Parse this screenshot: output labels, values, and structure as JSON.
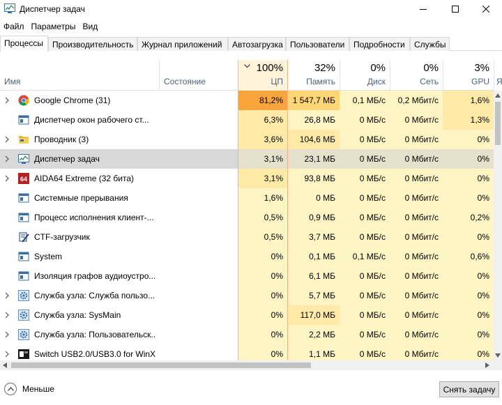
{
  "window": {
    "title": "Диспетчер задач"
  },
  "menu": [
    "Файл",
    "Параметры",
    "Вид"
  ],
  "tabs": [
    "Процессы",
    "Производительность",
    "Журнал приложений",
    "Автозагрузка",
    "Пользователи",
    "Подробности",
    "Службы"
  ],
  "columns": {
    "name": "Имя",
    "status": "Состояние",
    "cpu": {
      "pct": "100%",
      "label": "ЦП"
    },
    "mem": {
      "pct": "32%",
      "label": "Память"
    },
    "disk": {
      "pct": "0%",
      "label": "Диск"
    },
    "net": {
      "pct": "0%",
      "label": "Сеть"
    },
    "gpu": {
      "pct": "3%",
      "label": "GPU"
    },
    "gpu_engine": {
      "label": "Я"
    }
  },
  "processes": [
    {
      "name": "Google Chrome (31)",
      "icon": "chrome-icon",
      "expandable": true,
      "cpu": "81,2%",
      "mem": "1 547,7 МБ",
      "disk": "0,1 МБ/с",
      "net": "0,2 Мбит/с",
      "gpu": "1,6%"
    },
    {
      "name": "Диспетчер окон рабочего ст...",
      "icon": "window-manager-icon",
      "expandable": false,
      "cpu": "6,3%",
      "mem": "26,8 МБ",
      "disk": "0 МБ/с",
      "net": "0 Мбит/с",
      "gpu": "1,3%"
    },
    {
      "name": "Проводник (3)",
      "icon": "folder-icon",
      "expandable": true,
      "cpu": "3,6%",
      "mem": "104,6 МБ",
      "disk": "0 МБ/с",
      "net": "0 Мбит/с",
      "gpu": "0%"
    },
    {
      "name": "Диспетчер задач",
      "icon": "task-manager-icon",
      "expandable": true,
      "cpu": "3,1%",
      "mem": "23,1 МБ",
      "disk": "0 МБ/с",
      "net": "0 Мбит/с",
      "gpu": "0%"
    },
    {
      "name": "AIDA64 Extreme (32 бита)",
      "icon": "aida64-icon",
      "expandable": true,
      "cpu": "3,1%",
      "mem": "93,8 МБ",
      "disk": "0 МБ/с",
      "net": "0 Мбит/с",
      "gpu": "0%"
    },
    {
      "name": "Системные прерывания",
      "icon": "system-icon",
      "expandable": false,
      "cpu": "1,6%",
      "mem": "0 МБ",
      "disk": "0 МБ/с",
      "net": "0 Мбит/с",
      "gpu": "0%"
    },
    {
      "name": "Процесс исполнения клиент-...",
      "icon": "system-icon",
      "expandable": false,
      "cpu": "0,5%",
      "mem": "0,9 МБ",
      "disk": "0 МБ/с",
      "net": "0 Мбит/с",
      "gpu": "0,2%"
    },
    {
      "name": "CTF-загрузчик",
      "icon": "ctf-icon",
      "expandable": false,
      "cpu": "0,5%",
      "mem": "3,7 МБ",
      "disk": "0 МБ/с",
      "net": "0 Мбит/с",
      "gpu": "0%"
    },
    {
      "name": "System",
      "icon": "system-icon",
      "expandable": false,
      "cpu": "0%",
      "mem": "0,1 МБ",
      "disk": "0,1 МБ/с",
      "net": "0 Мбит/с",
      "gpu": "0,6%"
    },
    {
      "name": "Изоляция графов аудиоустро...",
      "icon": "system-icon",
      "expandable": false,
      "cpu": "0%",
      "mem": "6,1 МБ",
      "disk": "0 МБ/с",
      "net": "0 Мбит/с",
      "gpu": "0%"
    },
    {
      "name": "Служба узла: Служба пользо...",
      "icon": "gear-icon",
      "expandable": true,
      "cpu": "0%",
      "mem": "5,7 МБ",
      "disk": "0 МБ/с",
      "net": "0 Мбит/с",
      "gpu": "0%"
    },
    {
      "name": "Служба узла: SysMain",
      "icon": "gear-icon",
      "expandable": true,
      "cpu": "0%",
      "mem": "117,0 МБ",
      "disk": "0 МБ/с",
      "net": "0 Мбит/с",
      "gpu": "0%"
    },
    {
      "name": "Служба узла: Пользовательск...",
      "icon": "gear-icon",
      "expandable": true,
      "cpu": "0%",
      "mem": "2,2 МБ",
      "disk": "0 МБ/с",
      "net": "0 Мбит/с",
      "gpu": "0%"
    },
    {
      "name": "Switch USB2.0/USB3.0 for WinX...",
      "icon": "usb-app-icon",
      "expandable": true,
      "cpu": "0%",
      "mem": "1,1 МБ",
      "disk": "0 МБ/с",
      "net": "0 Мбит/с",
      "gpu": "0%"
    }
  ],
  "footer": {
    "fewer_details": "Меньше",
    "end_task": "Снять задачу"
  }
}
